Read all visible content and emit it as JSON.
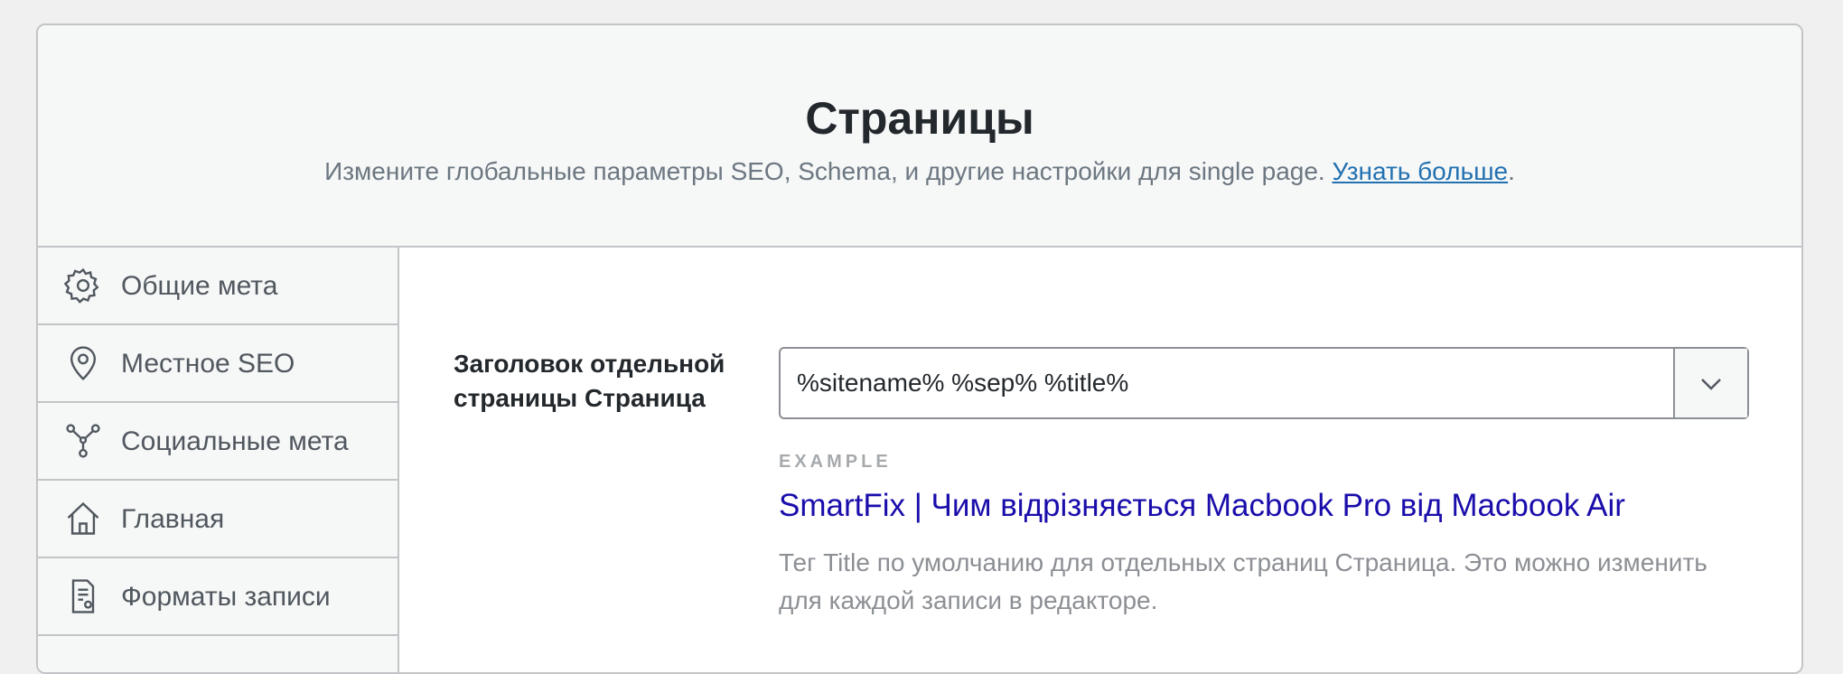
{
  "header": {
    "title": "Страницы",
    "description": "Измените глобальные параметры SEO, Schema, и другие настройки для single page.",
    "learn_more": "Узнать больше",
    "period": "."
  },
  "sidebar": {
    "items": [
      {
        "label": "Общие мета",
        "icon": "gear-icon"
      },
      {
        "label": "Местное SEO",
        "icon": "location-pin-icon"
      },
      {
        "label": "Социальные мета",
        "icon": "network-icon"
      },
      {
        "label": "Главная",
        "icon": "home-icon"
      },
      {
        "label": "Форматы записи",
        "icon": "document-icon"
      }
    ]
  },
  "main": {
    "field_label": "Заголовок отдельной страницы Страница",
    "select_value": "%sitename% %sep% %title%",
    "example_caption": "EXAMPLE",
    "example_title": "SmartFix | Чим відрізняється Macbook Pro від Macbook Air",
    "help_text": "Тег Title по умолчанию для отдельных страниц Страница. Это можно изменить для каждой записи в редакторе."
  },
  "colors": {
    "accent_link": "#2271b1",
    "example_title": "#1a0dab"
  }
}
